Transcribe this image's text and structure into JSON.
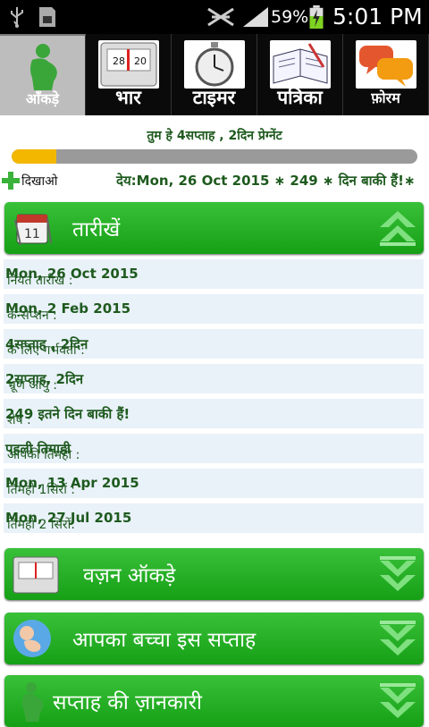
{
  "status_bar": {
    "battery_percent": "59%",
    "time": "5:01 PM",
    "icons": [
      "usb-icon",
      "sim-icon",
      "mute-icon",
      "signal-icon",
      "battery-charging-icon"
    ]
  },
  "tabs": [
    {
      "label": "आँकड़े",
      "icon": "pregnant-woman-icon",
      "active": true
    },
    {
      "label": "भार",
      "icon": "weighing-scale-icon",
      "active": false
    },
    {
      "label": "टाइमर",
      "icon": "stopwatch-icon",
      "active": false
    },
    {
      "label": "पत्रिका",
      "icon": "journal-icon",
      "active": false
    },
    {
      "label": "फ़ोरम",
      "icon": "chat-bubbles-icon",
      "active": false
    }
  ],
  "pregnancy": {
    "prefix": "तुम हे ",
    "weeks_days": "4सप्ताह , 2दिन",
    "suffix": " प्रेग्नेंट",
    "progress_percent": 11
  },
  "show_label": "दिखाओ",
  "due_line": "देय:Mon, 26 Oct 2015 ∗ 249 ∗ दिन बाकी हैं!∗",
  "dates_section": {
    "title": "तारीखें",
    "rows": [
      {
        "label": "नियत तारीख :",
        "value": "Mon, 26 Oct 2015"
      },
      {
        "label": "कन्सेप्शन :",
        "value": "Mon, 2 Feb 2015"
      },
      {
        "label": "के लिए गर्भवती :",
        "value": "4सप्ताह , 2दिन"
      },
      {
        "label": "भ्रूण आयु :",
        "value": "2सप्ताह, 2दिन"
      },
      {
        "label": "शेष :",
        "value": "249 इतने दिन बाकी हैं!"
      },
      {
        "label": "आपकी तिमही :",
        "value": "पहली तिमाही"
      },
      {
        "label": "तिमही 1सिरों :",
        "value": "Mon, 13 Apr 2015"
      },
      {
        "label": "तिमही 2 सिरों:",
        "value": "Mon, 27 Jul 2015"
      }
    ]
  },
  "sections": [
    {
      "title": "वज़न ऑकड़े",
      "icon": "weighing-scale-icon"
    },
    {
      "title": "आपका बच्चा इस सप्ताह",
      "icon": "baby-icon"
    },
    {
      "title": "सप्ताह की ज़ानकारी",
      "icon": "pregnant-woman-icon"
    }
  ],
  "colors": {
    "header_green": "#22b022",
    "text_green": "#1e5a1e",
    "progress_fill": "#f3b700",
    "row_bg": "#e9f1f9"
  }
}
